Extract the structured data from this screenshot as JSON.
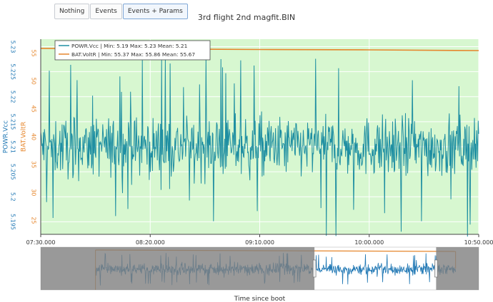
{
  "buttons": [
    {
      "label": "Nothing",
      "active": false
    },
    {
      "label": "Events",
      "active": false
    },
    {
      "label": "Events + Params",
      "active": true
    }
  ],
  "title": "3rd flight 2nd magfit.BIN",
  "xaxis_title": "Time since boot",
  "colors": {
    "vcc": "#1f8fa2",
    "voltr": "#e6862c",
    "plot_bg": "#d7f7d0",
    "range_line": "#1f77b4",
    "range_mask": "#7f7f7f",
    "y1_tick": "#1f77b4",
    "y2_tick": "#e6862c"
  },
  "chart_data": {
    "type": "line",
    "xlabel": "Time since boot",
    "x_ticks": [
      "07:30.000",
      "08:20.000",
      "09:10.000",
      "10:00.000",
      "10:50.000"
    ],
    "x_range_seconds": [
      450,
      650
    ],
    "y1": {
      "label": "POWR.Vcc",
      "range": [
        5.1925,
        5.2315
      ],
      "ticks": [
        5.195,
        5.2,
        5.205,
        5.21,
        5.215,
        5.22,
        5.225,
        5.23
      ]
    },
    "y2": {
      "label": "BAT.VoltR",
      "range": [
        22.5,
        57.5
      ],
      "ticks": [
        25,
        30,
        35,
        40,
        45,
        50,
        55
      ]
    },
    "legend_placement": "top-left",
    "series": [
      {
        "name": "POWR.Vcc",
        "legend": "POWR.Vcc | Min: 5.19      Max: 5.23      Mean: 5.21",
        "min": 5.19,
        "max": 5.23,
        "mean": 5.21,
        "axis": "y1"
      },
      {
        "name": "BAT.VoltR",
        "legend": "BAT.VoltR | Min: 55.37      Max: 55.86      Mean: 55.67",
        "min": 55.37,
        "max": 55.86,
        "mean": 55.67,
        "axis": "y2",
        "x": [
          450,
          500,
          550,
          600,
          650
        ],
        "y": [
          55.85,
          55.75,
          55.65,
          55.58,
          55.45
        ]
      }
    ],
    "rangeslider": {
      "full_range_seconds": [
        0,
        720
      ],
      "selected_seconds": [
        450,
        650
      ]
    }
  }
}
